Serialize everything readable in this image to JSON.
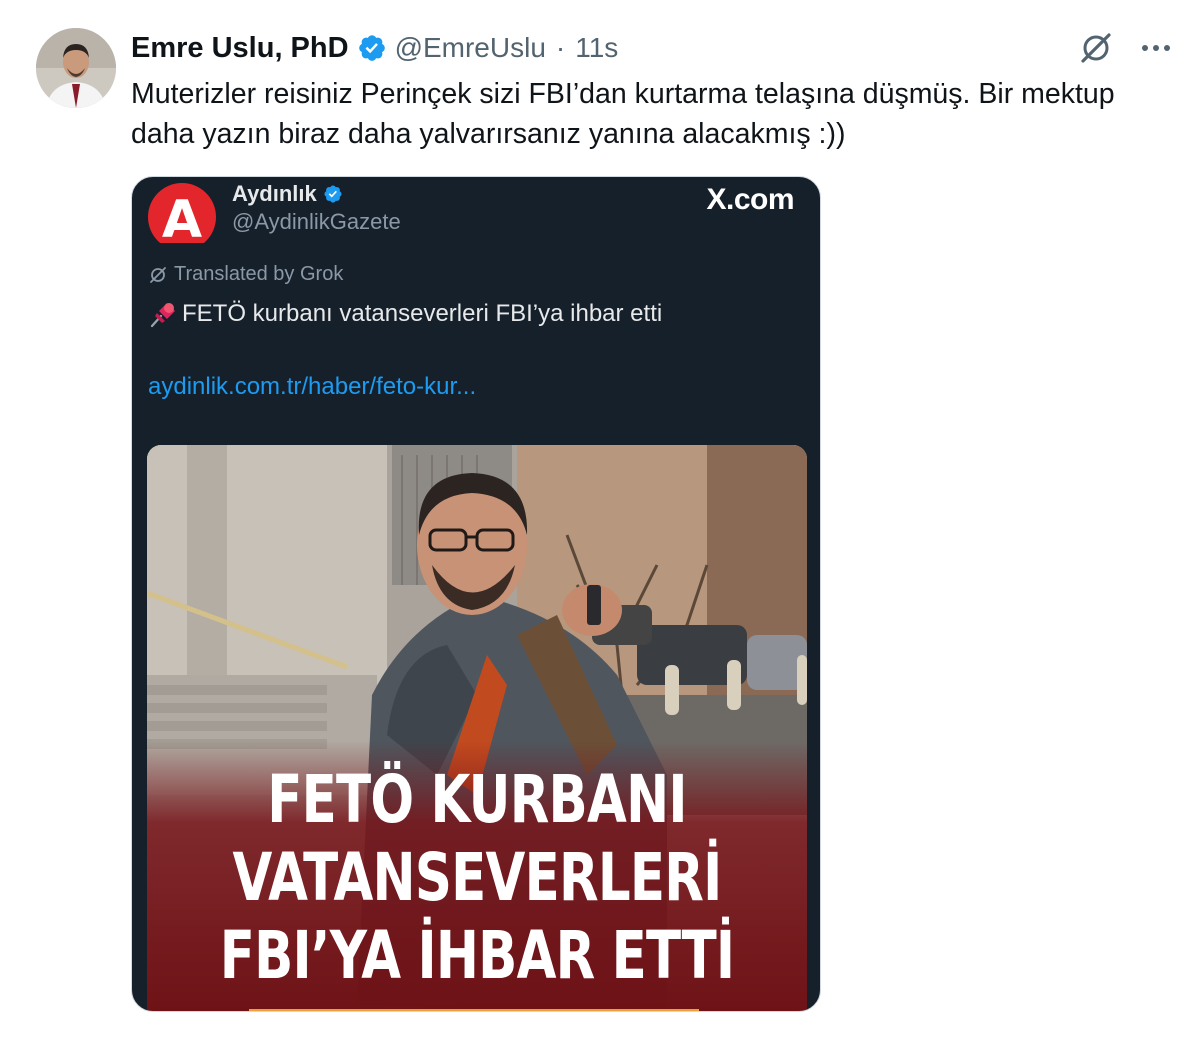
{
  "tweet": {
    "author_name": "Emre Uslu, PhD",
    "handle": "@EmreUslu",
    "separator": "·",
    "time": "11s",
    "text": "Muterizler reisiniz Perinçek sizi FBI’dan kurtarma telaşına düşmüş. Bir mektup daha yazın biraz daha yalvarırsanız yanına alacakmış :))",
    "verified_color": "#1d9bf0",
    "icons": [
      "grok-icon",
      "more-icon"
    ]
  },
  "embedded": {
    "account_name": "Aydınlık",
    "account_handle": "@AydinlikGazete",
    "logo_letter": "A",
    "logo_color": "#e3262b",
    "watermark": "X.com",
    "translated_label": "Translated by Grok",
    "headline": "FETÖ kurbanı vatanseverleri FBI’ya ihbar etti",
    "link": "aydinlik.com.tr/haber/feto-kur...",
    "photo_caption_lines": [
      "FETÖ KURBANI",
      "VATANSEVERLERİ",
      "FBI’YA İHBAR ETTİ"
    ],
    "background": "#15202b",
    "link_color": "#1d9bf0"
  }
}
